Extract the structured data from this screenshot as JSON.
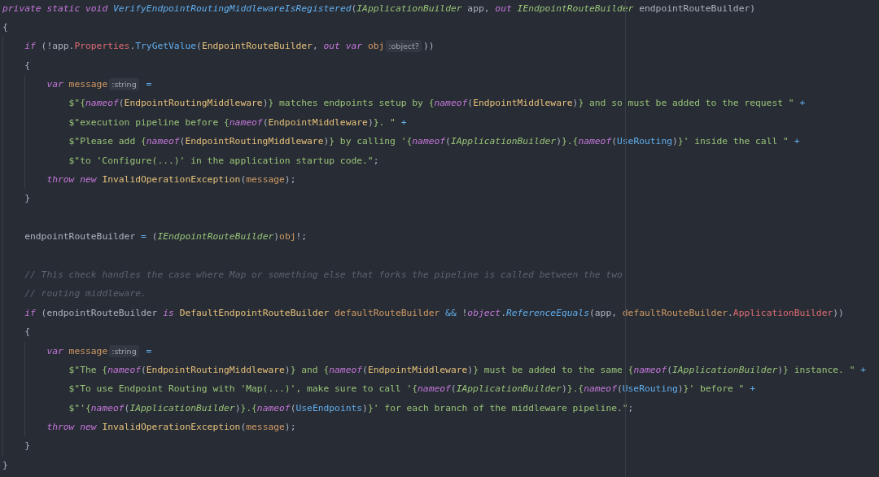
{
  "lines": [
    {
      "tokens": [
        {
          "text": "private static void ",
          "kind": "keyword"
        },
        {
          "text": "VerifyEndpointRoutingMiddlewareIsRegistered",
          "kind": "static"
        },
        {
          "text": "(",
          "kind": "plain"
        },
        {
          "text": "IApplicationBuilder",
          "kind": "interface"
        },
        {
          "text": " app, ",
          "kind": "plain"
        },
        {
          "text": "out ",
          "kind": "keyword"
        },
        {
          "text": "IEndpointRouteBuilder",
          "kind": "interface"
        },
        {
          "text": " endpointRouteBuilder)",
          "kind": "plain"
        }
      ]
    },
    {
      "tokens": [
        {
          "text": "{",
          "kind": "plain"
        }
      ],
      "guide": true,
      "children": [
        {
          "tokens": [
            {
              "text": "if",
              "kind": "keyword"
            },
            {
              "text": " (!app.",
              "kind": "plain"
            },
            {
              "text": "Properties",
              "kind": "property"
            },
            {
              "text": ".",
              "kind": "plain"
            },
            {
              "text": "TryGetValue",
              "kind": "method"
            },
            {
              "text": "(",
              "kind": "plain"
            },
            {
              "text": "EndpointRouteBuilder",
              "kind": "type"
            },
            {
              "text": ", ",
              "kind": "plain"
            },
            {
              "text": "out var ",
              "kind": "keyword"
            },
            {
              "text": "obj",
              "kind": "local"
            },
            {
              "text": ":object?",
              "kind": "hint"
            },
            {
              "text": "))",
              "kind": "plain"
            }
          ]
        },
        {
          "tokens": [
            {
              "text": "{",
              "kind": "plain"
            }
          ],
          "guide": true,
          "children": [
            {
              "tokens": [
                {
                  "text": "var ",
                  "kind": "keyword"
                },
                {
                  "text": "message",
                  "kind": "local"
                },
                {
                  "text": ":string",
                  "kind": "hint"
                },
                {
                  "text": " =",
                  "kind": "operator"
                }
              ],
              "guide": false,
              "children": [
                {
                  "tokens": [
                    {
                      "text": "$\"{",
                      "kind": "string"
                    },
                    {
                      "text": "nameof",
                      "kind": "keyword"
                    },
                    {
                      "text": "(",
                      "kind": "plain"
                    },
                    {
                      "text": "EndpointRoutingMiddleware",
                      "kind": "type"
                    },
                    {
                      "text": ")",
                      "kind": "plain"
                    },
                    {
                      "text": "} matches endpoints setup by {",
                      "kind": "string"
                    },
                    {
                      "text": "nameof",
                      "kind": "keyword"
                    },
                    {
                      "text": "(",
                      "kind": "plain"
                    },
                    {
                      "text": "EndpointMiddleware",
                      "kind": "type"
                    },
                    {
                      "text": ")",
                      "kind": "plain"
                    },
                    {
                      "text": "} and so must be added to the request \"",
                      "kind": "string"
                    },
                    {
                      "text": " +",
                      "kind": "operator"
                    }
                  ]
                },
                {
                  "tokens": [
                    {
                      "text": "$\"execution pipeline before {",
                      "kind": "string"
                    },
                    {
                      "text": "nameof",
                      "kind": "keyword"
                    },
                    {
                      "text": "(",
                      "kind": "plain"
                    },
                    {
                      "text": "EndpointMiddleware",
                      "kind": "type"
                    },
                    {
                      "text": ")",
                      "kind": "plain"
                    },
                    {
                      "text": "}. \"",
                      "kind": "string"
                    },
                    {
                      "text": " +",
                      "kind": "operator"
                    }
                  ]
                },
                {
                  "tokens": [
                    {
                      "text": "$\"Please add {",
                      "kind": "string"
                    },
                    {
                      "text": "nameof",
                      "kind": "keyword"
                    },
                    {
                      "text": "(",
                      "kind": "plain"
                    },
                    {
                      "text": "EndpointRoutingMiddleware",
                      "kind": "type"
                    },
                    {
                      "text": ")",
                      "kind": "plain"
                    },
                    {
                      "text": "} by calling '{",
                      "kind": "string"
                    },
                    {
                      "text": "nameof",
                      "kind": "keyword"
                    },
                    {
                      "text": "(",
                      "kind": "plain"
                    },
                    {
                      "text": "IApplicationBuilder",
                      "kind": "interface"
                    },
                    {
                      "text": ")",
                      "kind": "plain"
                    },
                    {
                      "text": "}.{",
                      "kind": "string"
                    },
                    {
                      "text": "nameof",
                      "kind": "keyword"
                    },
                    {
                      "text": "(",
                      "kind": "plain"
                    },
                    {
                      "text": "UseRouting",
                      "kind": "method"
                    },
                    {
                      "text": ")",
                      "kind": "plain"
                    },
                    {
                      "text": "}' inside the call \"",
                      "kind": "string"
                    },
                    {
                      "text": " +",
                      "kind": "operator"
                    }
                  ]
                },
                {
                  "tokens": [
                    {
                      "text": "$\"to 'Configure(...)' in the application startup code.\"",
                      "kind": "string"
                    },
                    {
                      "text": ";",
                      "kind": "plain"
                    }
                  ]
                }
              ]
            },
            {
              "tokens": [
                {
                  "text": "throw new ",
                  "kind": "keyword"
                },
                {
                  "text": "InvalidOperationException",
                  "kind": "type"
                },
                {
                  "text": "(",
                  "kind": "plain"
                },
                {
                  "text": "message",
                  "kind": "local"
                },
                {
                  "text": ");",
                  "kind": "plain"
                }
              ]
            }
          ]
        },
        {
          "tokens": [
            {
              "text": "}",
              "kind": "plain"
            }
          ]
        },
        {
          "blank_before": true,
          "tokens": [
            {
              "text": "endpointRouteBuilder ",
              "kind": "plain"
            },
            {
              "text": "=",
              "kind": "operator"
            },
            {
              "text": " (",
              "kind": "plain"
            },
            {
              "text": "IEndpointRouteBuilder",
              "kind": "interface"
            },
            {
              "text": ")",
              "kind": "plain"
            },
            {
              "text": "obj",
              "kind": "local"
            },
            {
              "text": "!;",
              "kind": "plain"
            }
          ]
        },
        {
          "blank_before": true,
          "tokens": [
            {
              "text": "// This check handles the case where Map or something else that forks the pipeline is called between the two",
              "kind": "comment"
            }
          ]
        },
        {
          "tokens": [
            {
              "text": "// routing middleware.",
              "kind": "comment"
            }
          ]
        },
        {
          "tokens": [
            {
              "text": "if",
              "kind": "keyword"
            },
            {
              "text": " (endpointRouteBuilder ",
              "kind": "plain"
            },
            {
              "text": "is ",
              "kind": "keyword"
            },
            {
              "text": "DefaultEndpointRouteBuilder ",
              "kind": "type"
            },
            {
              "text": "defaultRouteBuilder",
              "kind": "local"
            },
            {
              "text": " &&",
              "kind": "operator"
            },
            {
              "text": " !",
              "kind": "plain"
            },
            {
              "text": "object",
              "kind": "keyword"
            },
            {
              "text": ".",
              "kind": "plain"
            },
            {
              "text": "ReferenceEquals",
              "kind": "static"
            },
            {
              "text": "(app, ",
              "kind": "plain"
            },
            {
              "text": "defaultRouteBuilder",
              "kind": "local"
            },
            {
              "text": ".",
              "kind": "plain"
            },
            {
              "text": "ApplicationBuilder",
              "kind": "property"
            },
            {
              "text": "))",
              "kind": "plain"
            }
          ]
        },
        {
          "tokens": [
            {
              "text": "{",
              "kind": "plain"
            }
          ],
          "guide": true,
          "children": [
            {
              "tokens": [
                {
                  "text": "var ",
                  "kind": "keyword"
                },
                {
                  "text": "message",
                  "kind": "local"
                },
                {
                  "text": ":string",
                  "kind": "hint"
                },
                {
                  "text": " =",
                  "kind": "operator"
                }
              ],
              "guide": false,
              "children": [
                {
                  "tokens": [
                    {
                      "text": "$\"The {",
                      "kind": "string"
                    },
                    {
                      "text": "nameof",
                      "kind": "keyword"
                    },
                    {
                      "text": "(",
                      "kind": "plain"
                    },
                    {
                      "text": "EndpointRoutingMiddleware",
                      "kind": "type"
                    },
                    {
                      "text": ")",
                      "kind": "plain"
                    },
                    {
                      "text": "} and {",
                      "kind": "string"
                    },
                    {
                      "text": "nameof",
                      "kind": "keyword"
                    },
                    {
                      "text": "(",
                      "kind": "plain"
                    },
                    {
                      "text": "EndpointMiddleware",
                      "kind": "type"
                    },
                    {
                      "text": ")",
                      "kind": "plain"
                    },
                    {
                      "text": "} must be added to the same {",
                      "kind": "string"
                    },
                    {
                      "text": "nameof",
                      "kind": "keyword"
                    },
                    {
                      "text": "(",
                      "kind": "plain"
                    },
                    {
                      "text": "IApplicationBuilder",
                      "kind": "interface"
                    },
                    {
                      "text": ")",
                      "kind": "plain"
                    },
                    {
                      "text": "} instance. \"",
                      "kind": "string"
                    },
                    {
                      "text": " +",
                      "kind": "operator"
                    }
                  ]
                },
                {
                  "tokens": [
                    {
                      "text": "$\"To use Endpoint Routing with 'Map(...)', make sure to call '{",
                      "kind": "string"
                    },
                    {
                      "text": "nameof",
                      "kind": "keyword"
                    },
                    {
                      "text": "(",
                      "kind": "plain"
                    },
                    {
                      "text": "IApplicationBuilder",
                      "kind": "interface"
                    },
                    {
                      "text": ")",
                      "kind": "plain"
                    },
                    {
                      "text": "}.{",
                      "kind": "string"
                    },
                    {
                      "text": "nameof",
                      "kind": "keyword"
                    },
                    {
                      "text": "(",
                      "kind": "plain"
                    },
                    {
                      "text": "UseRouting",
                      "kind": "method"
                    },
                    {
                      "text": ")",
                      "kind": "plain"
                    },
                    {
                      "text": "}' before \"",
                      "kind": "string"
                    },
                    {
                      "text": " +",
                      "kind": "operator"
                    }
                  ]
                },
                {
                  "tokens": [
                    {
                      "text": "$\"'{",
                      "kind": "string"
                    },
                    {
                      "text": "nameof",
                      "kind": "keyword"
                    },
                    {
                      "text": "(",
                      "kind": "plain"
                    },
                    {
                      "text": "IApplicationBuilder",
                      "kind": "interface"
                    },
                    {
                      "text": ")",
                      "kind": "plain"
                    },
                    {
                      "text": "}.{",
                      "kind": "string"
                    },
                    {
                      "text": "nameof",
                      "kind": "keyword"
                    },
                    {
                      "text": "(",
                      "kind": "plain"
                    },
                    {
                      "text": "UseEndpoints",
                      "kind": "method"
                    },
                    {
                      "text": ")",
                      "kind": "plain"
                    },
                    {
                      "text": "}' for each branch of the middleware pipeline.\"",
                      "kind": "string"
                    },
                    {
                      "text": ";",
                      "kind": "plain"
                    }
                  ]
                }
              ]
            },
            {
              "tokens": [
                {
                  "text": "throw new ",
                  "kind": "keyword"
                },
                {
                  "text": "InvalidOperationException",
                  "kind": "type"
                },
                {
                  "text": "(",
                  "kind": "plain"
                },
                {
                  "text": "message",
                  "kind": "local"
                },
                {
                  "text": ");",
                  "kind": "plain"
                }
              ]
            }
          ]
        },
        {
          "tokens": [
            {
              "text": "}",
              "kind": "plain"
            }
          ]
        }
      ]
    },
    {
      "tokens": [
        {
          "text": "}",
          "kind": "plain"
        }
      ]
    }
  ]
}
